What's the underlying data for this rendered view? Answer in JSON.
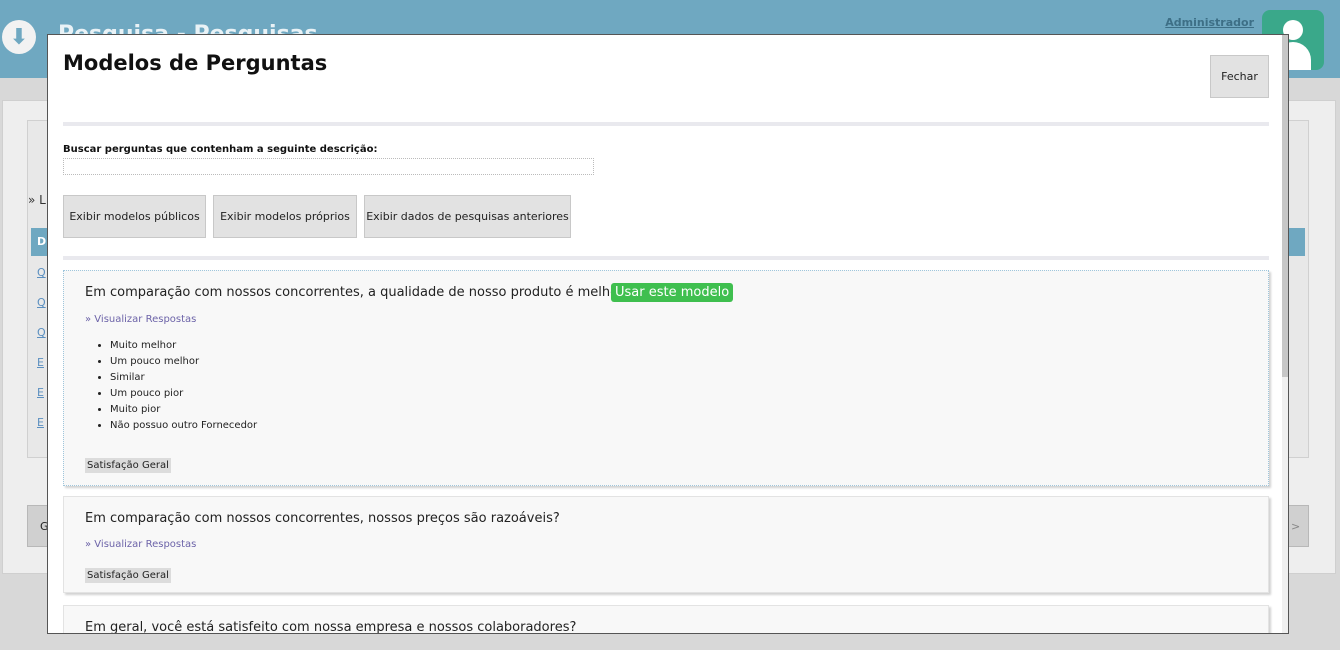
{
  "background": {
    "app_title": "Pesquisa - Pesquisas",
    "admin_link": "Administrador",
    "list_title": "» Li",
    "header_cell": "D",
    "links": [
      "Q",
      "Q",
      "Q",
      "E",
      "E",
      "E"
    ],
    "bottom_left_button": "G",
    "bottom_right_button": ">",
    "icons": [
      "download-icon",
      "user-avatar-icon"
    ],
    "colors": {
      "topbar": "#6fa8c1",
      "avatar": "#3aa88a"
    }
  },
  "modal": {
    "title": "Modelos de Perguntas",
    "close_label": "Fechar",
    "search_label": "Buscar perguntas que contenham a seguinte descrição:",
    "search_value": "",
    "filters": [
      "Exibir modelos públicos",
      "Exibir modelos próprios",
      "Exibir dados de pesquisas anteriores"
    ],
    "questions": [
      {
        "text": "Em comparação com nossos concorrentes, a qualidade de nosso produto é melhor?",
        "use_label": "Usar este modelo",
        "view_label": "» Visualizar Respostas",
        "answers": [
          "Muito melhor",
          "Um pouco melhor",
          "Similar",
          "Um pouco pior",
          "Muito pior",
          "Não possuo outro Fornecedor"
        ],
        "tag": "Satisfação Geral"
      },
      {
        "text": "Em comparação com nossos concorrentes, nossos preços são razoáveis?",
        "view_label": "» Visualizar Respostas",
        "tag": "Satisfação Geral"
      },
      {
        "text": "Em geral, você está satisfeito com nossa empresa e nossos colaboradores?"
      }
    ],
    "colors": {
      "use_button": "#3fbf4f",
      "link": "#6c63a8"
    }
  }
}
